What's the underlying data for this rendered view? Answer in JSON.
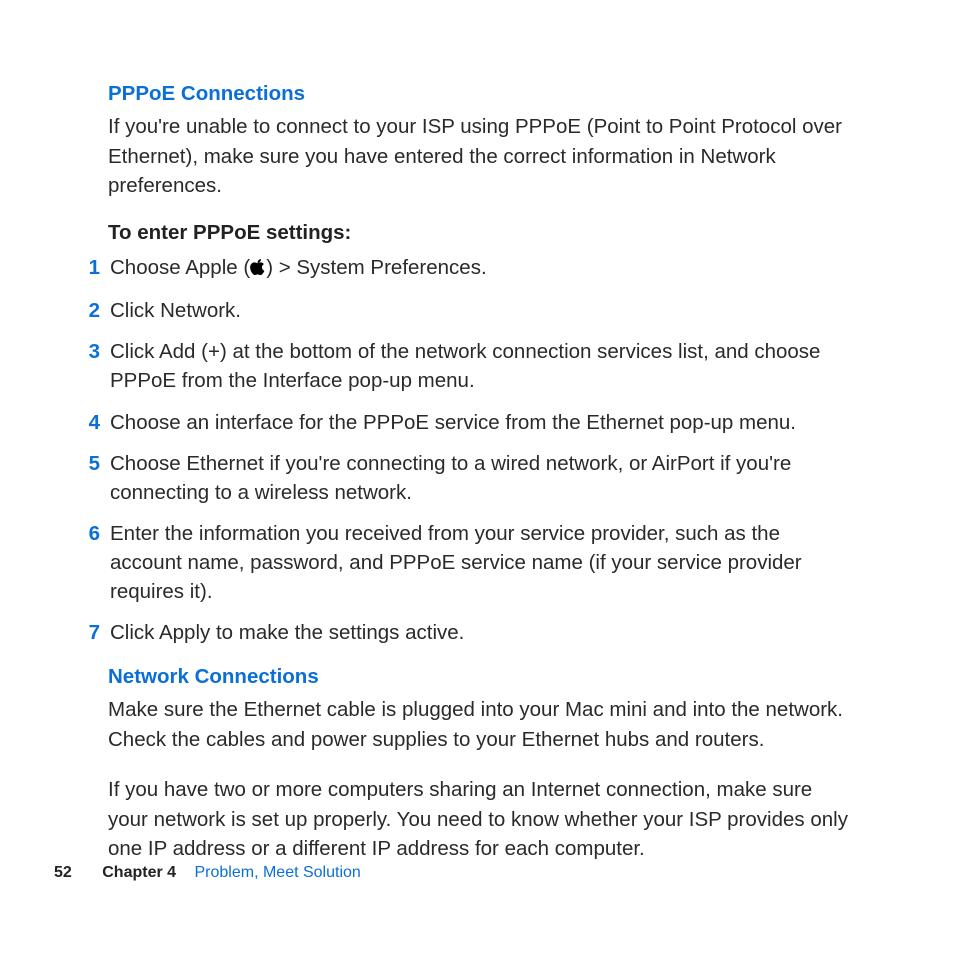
{
  "section1": {
    "heading": "PPPoE Connections",
    "intro": "If you're unable to connect to your ISP using PPPoE (Point to Point Protocol over Ethernet), make sure you have entered the correct information in Network preferences.",
    "subheading": "To enter PPPoE settings:",
    "steps": [
      {
        "n": "1",
        "pre": "Choose Apple (",
        "post": ") > System Preferences."
      },
      {
        "n": "2",
        "text": "Click Network."
      },
      {
        "n": "3",
        "text": "Click Add (+) at the bottom of the network connection services list, and choose PPPoE from the Interface pop-up menu."
      },
      {
        "n": "4",
        "text": "Choose an interface for the PPPoE service from the Ethernet pop-up menu."
      },
      {
        "n": "5",
        "text": "Choose Ethernet if you're connecting to a wired network, or AirPort if you're connecting to a wireless network."
      },
      {
        "n": "6",
        "text": "Enter the information you received from your service provider, such as the account name, password, and PPPoE service name (if your service provider requires it)."
      },
      {
        "n": "7",
        "text": "Click Apply to make the settings active."
      }
    ]
  },
  "section2": {
    "heading": "Network Connections",
    "para1": "Make sure the Ethernet cable is plugged into your Mac mini and into the network. Check the cables and power supplies to your Ethernet hubs and routers.",
    "para2": "If you have two or more computers sharing an Internet connection, make sure your network is set up properly. You need to know whether your ISP provides only one IP address or a different IP address for each computer."
  },
  "footer": {
    "page": "52",
    "chapter": "Chapter 4",
    "title": "Problem, Meet Solution"
  }
}
